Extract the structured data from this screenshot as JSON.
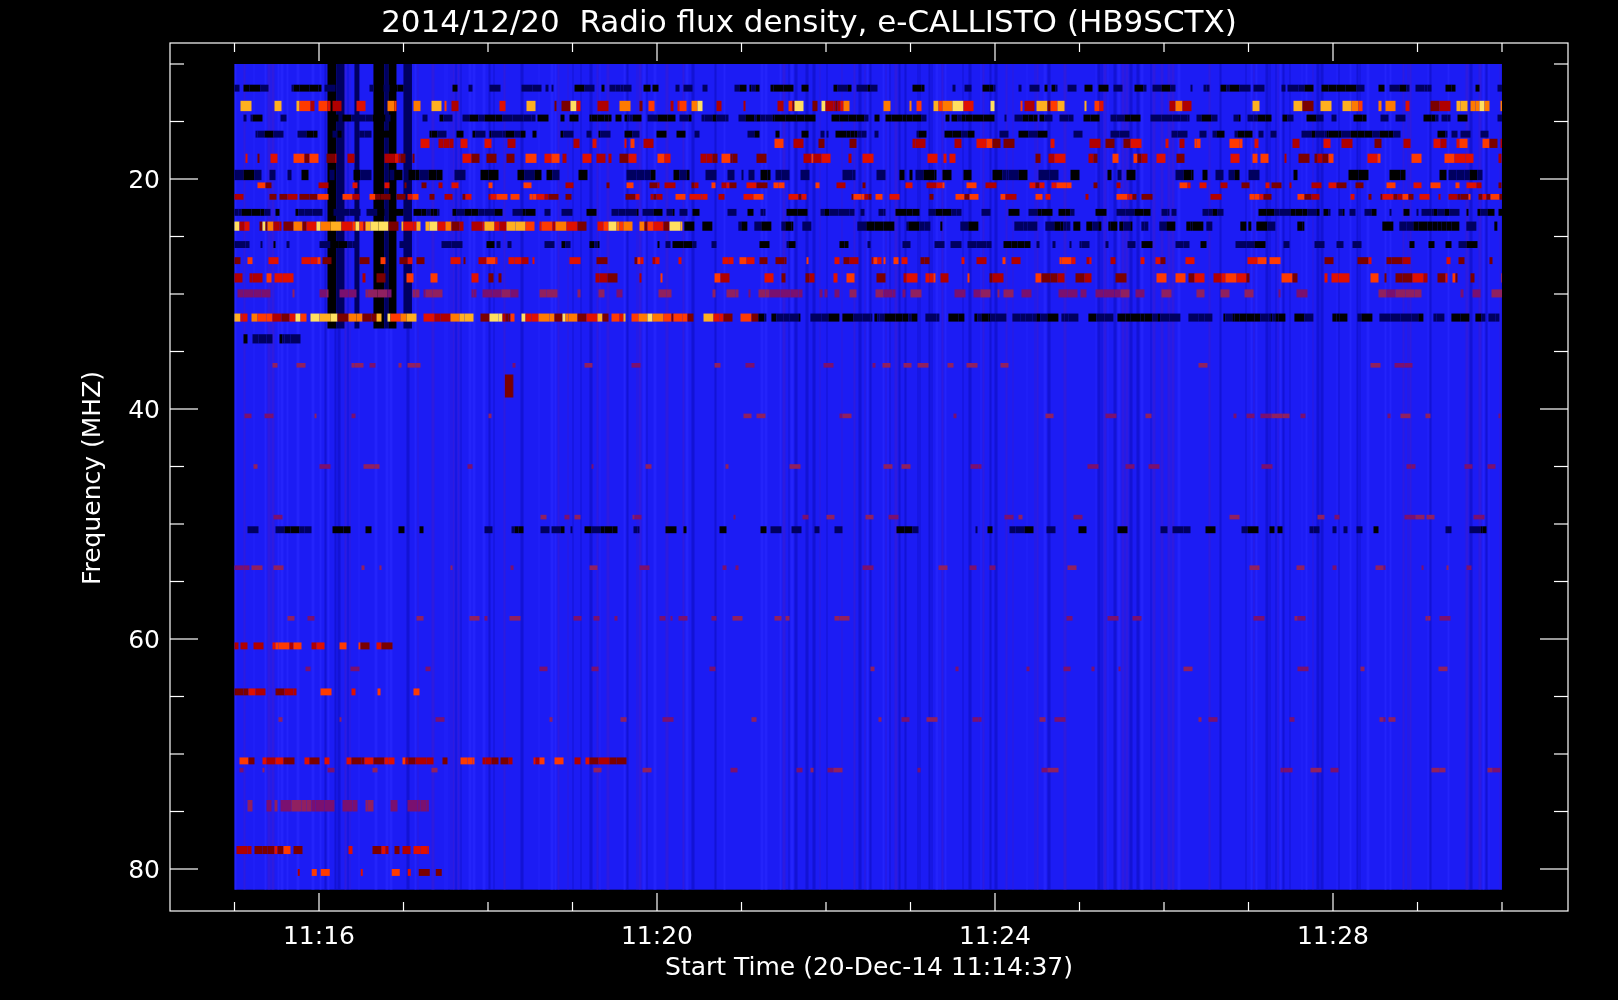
{
  "title": "2014/12/20  Radio flux density, e-CALLISTO (HB9SCTX)",
  "y_axis": {
    "label": "Frequency (MHZ)",
    "ticks": [
      "20",
      "40",
      "60",
      "80"
    ]
  },
  "x_axis": {
    "label": "Start Time (20-Dec-14 11:14:37)",
    "ticks": [
      "11:16",
      "11:20",
      "11:24",
      "11:28"
    ]
  }
}
